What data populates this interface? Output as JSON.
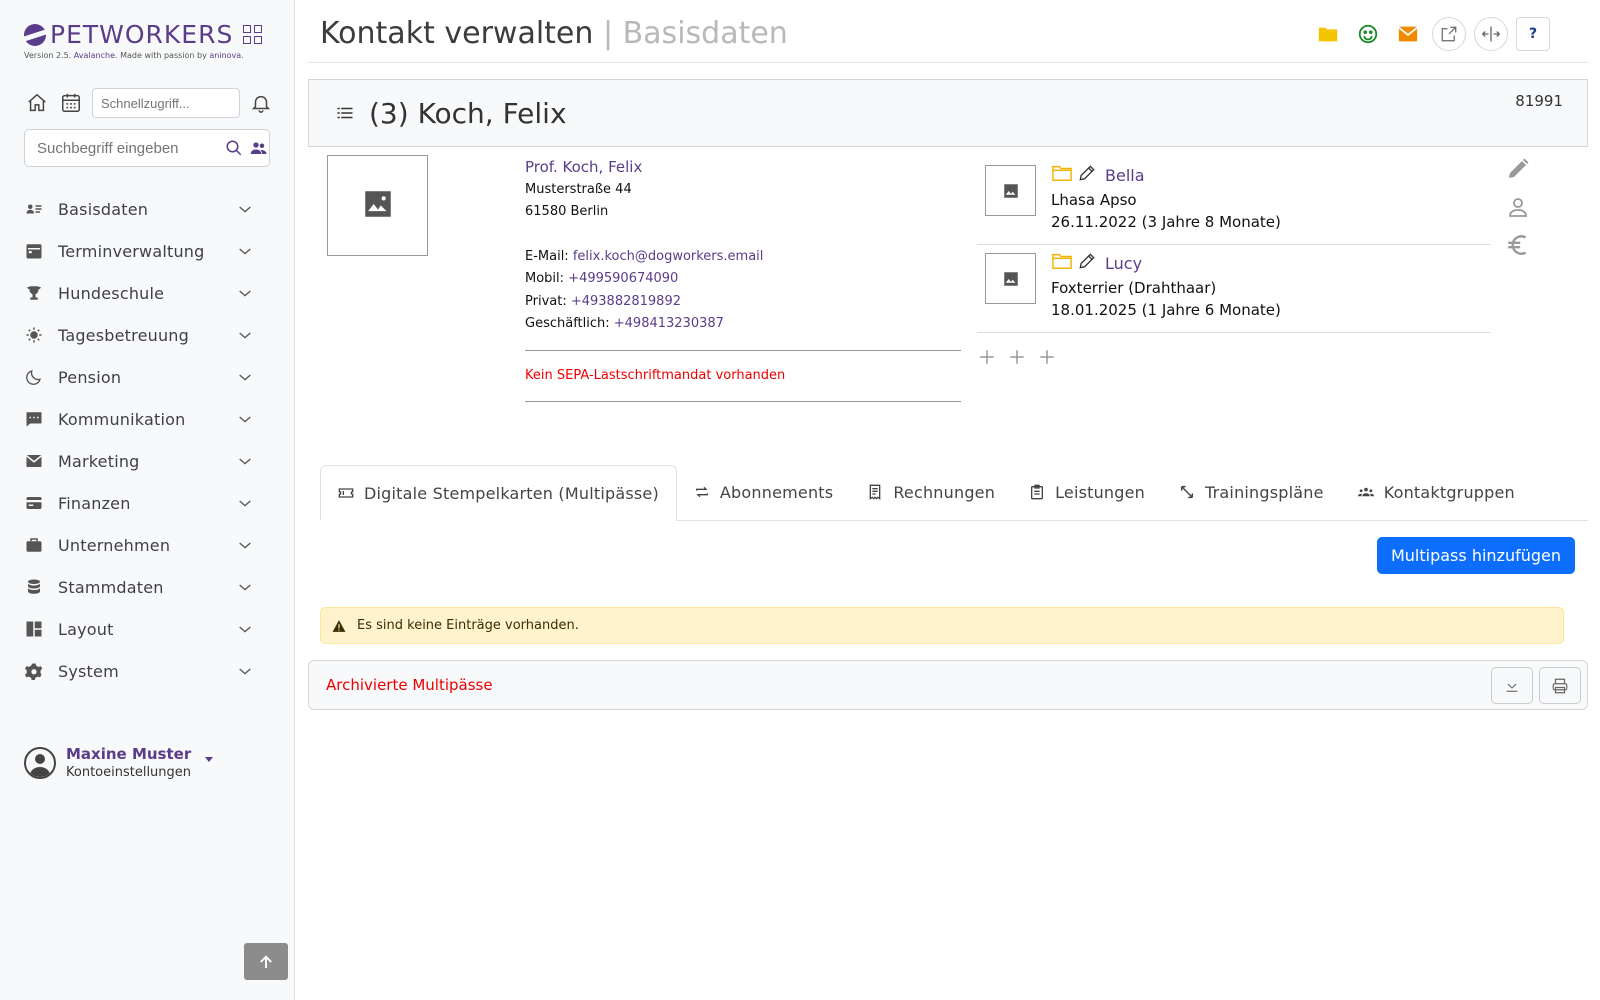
{
  "brand": {
    "name": "PETWORKERS",
    "version_prefix": "Version 2.5. ",
    "version_name": "Avalanche",
    "version_mid": ". Made with passion by ",
    "version_company": "aninova",
    "version_suffix": "."
  },
  "quick": {
    "placeholder": "Schnellzugriff..."
  },
  "search": {
    "placeholder": "Suchbegriff eingeben"
  },
  "nav": [
    {
      "label": "Basisdaten",
      "icon": "contact-card-icon"
    },
    {
      "label": "Terminverwaltung",
      "icon": "calendar-icon"
    },
    {
      "label": "Hundeschule",
      "icon": "trophy-icon"
    },
    {
      "label": "Tagesbetreuung",
      "icon": "sun-icon"
    },
    {
      "label": "Pension",
      "icon": "moon-icon"
    },
    {
      "label": "Kommunikation",
      "icon": "chat-icon"
    },
    {
      "label": "Marketing",
      "icon": "mail-icon"
    },
    {
      "label": "Finanzen",
      "icon": "credit-card-icon"
    },
    {
      "label": "Unternehmen",
      "icon": "briefcase-icon"
    },
    {
      "label": "Stammdaten",
      "icon": "database-icon"
    },
    {
      "label": "Layout",
      "icon": "layout-icon"
    },
    {
      "label": "System",
      "icon": "gear-icon"
    }
  ],
  "user": {
    "name": "Maxine Muster",
    "sub": "Kontoeinstellungen"
  },
  "header": {
    "title": "Kontakt verwalten",
    "separator": " | ",
    "subtitle": "Basisdaten"
  },
  "contact": {
    "heading": "(3) Koch, Felix",
    "id": "81991",
    "full_name": "Prof. Koch, Felix",
    "street": "Musterstraße 44",
    "city": "61580 Berlin",
    "email_label": "E-Mail: ",
    "email": "felix.koch@dogworkers.email",
    "mobile_label": "Mobil: ",
    "mobile": "+499590674090",
    "private_label": "Privat: ",
    "private": "+493882819892",
    "business_label": "Geschäftlich: ",
    "business": "+498413230387",
    "sepa": "Kein SEPA-Lastschriftmandat vorhanden"
  },
  "pets": [
    {
      "name": "Bella",
      "breed": "Lhasa Apso",
      "dob": "26.11.2022 (3 Jahre 8 Monate)"
    },
    {
      "name": "Lucy",
      "breed": "Foxterrier (Drahthaar)",
      "dob": "18.01.2025 (1 Jahre 6 Monate)"
    }
  ],
  "tabs": [
    {
      "label": "Digitale Stempelkarten (Multipässe)",
      "icon": "ticket-icon",
      "active": true
    },
    {
      "label": "Abonnements",
      "icon": "repeat-icon"
    },
    {
      "label": "Rechnungen",
      "icon": "receipt-icon"
    },
    {
      "label": "Leistungen",
      "icon": "clipboard-icon"
    },
    {
      "label": "Trainingspläne",
      "icon": "resize-icon"
    },
    {
      "label": "Kontaktgruppen",
      "icon": "group-icon"
    }
  ],
  "add_button": "Multipass hinzufügen",
  "alert": "Es sind keine Einträge vorhanden.",
  "archived": "Archivierte Multipässe",
  "colors": {
    "accent": "#5a3d8a",
    "primary": "#0d6efd",
    "danger": "#e00000",
    "warning_bg": "#fff3cd"
  }
}
